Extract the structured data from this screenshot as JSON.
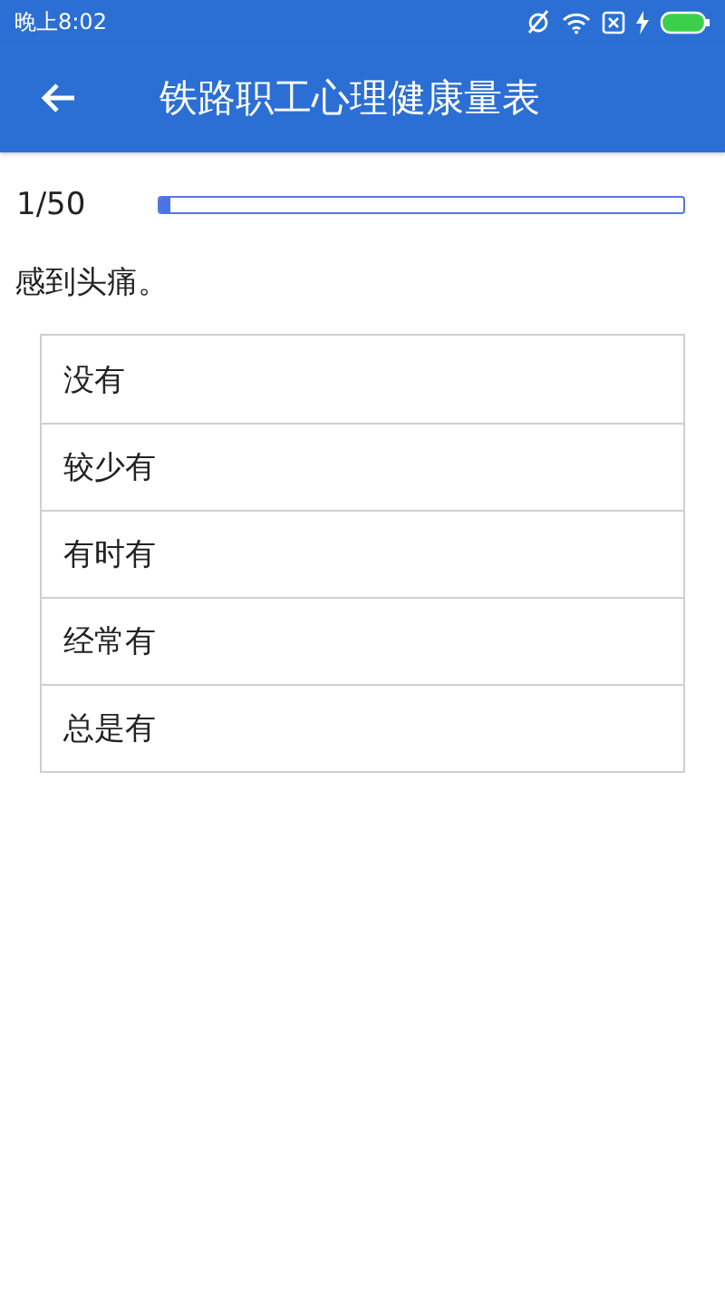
{
  "status_bar": {
    "time": "晚上8:02"
  },
  "app_bar": {
    "title": "铁路职工心理健康量表"
  },
  "progress": {
    "counter": "1/50",
    "level": 0.02
  },
  "question": "感到头痛。",
  "options": [
    {
      "label": "没有"
    },
    {
      "label": "较少有"
    },
    {
      "label": "有时有"
    },
    {
      "label": "经常有"
    },
    {
      "label": "总是有"
    }
  ]
}
